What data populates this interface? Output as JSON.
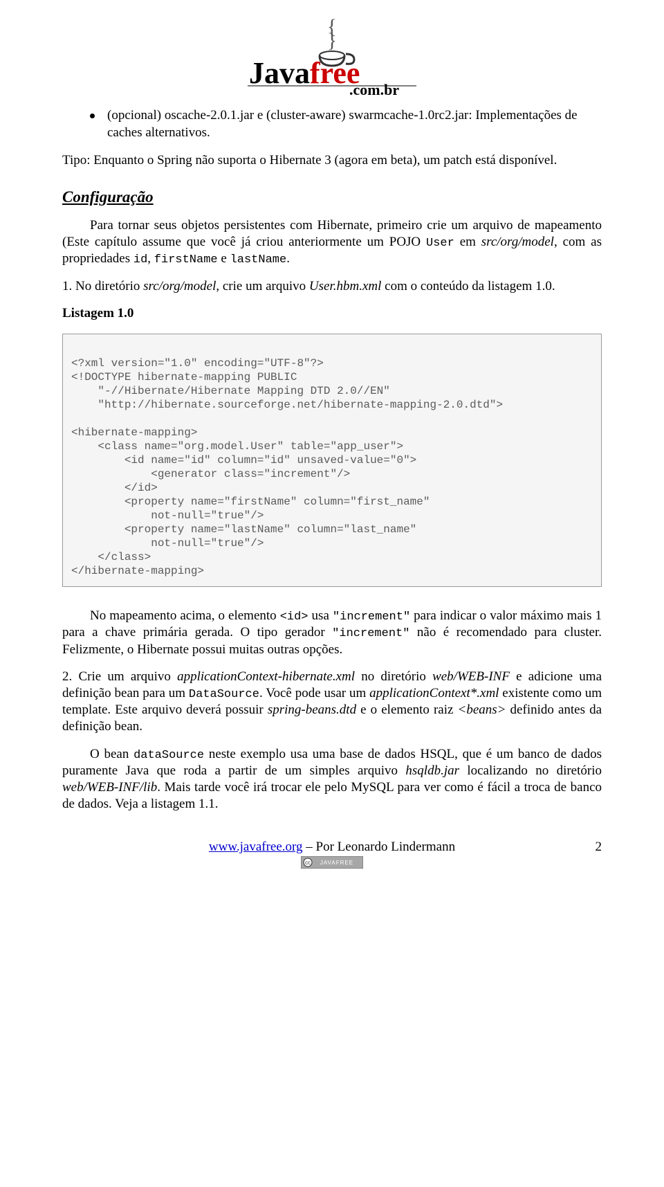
{
  "logo": {
    "brand_java": "Java",
    "brand_free": "free",
    "domain": ".com.br"
  },
  "bullet1_text": "(opcional) oscache-2.0.1.jar e (cluster-aware) swarmcache-1.0rc2.jar: Implementações de caches alternativos.",
  "tip_text": "Tipo: Enquanto o Spring não suporta o Hibernate 3 (agora em beta), um patch está disponível.",
  "config": {
    "heading": "Configuração",
    "intro_pre": "Para tornar seus objetos persistentes com Hibernate, primeiro crie um arquivo de mapeamento (Este capítulo assume que você já criou anteriormente um POJO ",
    "intro_code1": "User",
    "intro_mid": " em ",
    "intro_italic": "src/org/model",
    "intro_post": ", com as propriedades ",
    "intro_code2": "id",
    "intro_sep": ", ",
    "intro_code3": "firstName",
    "intro_and": " e ",
    "intro_code4": "lastName",
    "intro_end": "."
  },
  "step1": {
    "pre": "1. No diretório ",
    "italic1": "src/org/model",
    "mid1": ", crie um arquivo ",
    "italic2": "User.hbm.xml",
    "post": " com o conteúdo da listagem 1.0."
  },
  "listing1_label": "Listagem 1.0",
  "listing1_code": "\n<?xml version=\"1.0\" encoding=\"UTF-8\"?>\n<!DOCTYPE hibernate-mapping PUBLIC\n    \"-//Hibernate/Hibernate Mapping DTD 2.0//EN\"\n    \"http://hibernate.sourceforge.net/hibernate-mapping-2.0.dtd\">\n\n<hibernate-mapping>\n    <class name=\"org.model.User\" table=\"app_user\">\n        <id name=\"id\" column=\"id\" unsaved-value=\"0\">\n            <generator class=\"increment\"/>\n        </id>\n        <property name=\"firstName\" column=\"first_name\"\n            not-null=\"true\"/>\n        <property name=\"lastName\" column=\"last_name\"\n            not-null=\"true\"/>\n    </class>\n</hibernate-mapping>\n",
  "mapping_para": {
    "pre": "No mapeamento acima, o elemento ",
    "code1": "<id>",
    "mid1": " usa ",
    "code2": "\"increment\"",
    "mid2": " para indicar o valor máximo mais 1 para a chave primária gerada. O tipo gerador ",
    "code3": "\"increment\"",
    "post": " não é recomendado para cluster. Felizmente, o Hibernate possui muitas outras opções."
  },
  "step2": {
    "pre": "2. Crie um arquivo ",
    "italic1": "applicationContext-hibernate.xml",
    "mid1": " no diretório ",
    "italic2": "web/WEB-INF",
    "mid2": " e adicione uma definição bean para um ",
    "code1": "DataSource",
    "mid3": ". Você pode usar um ",
    "italic3": "applicationContext*.xml",
    "mid4": " existente como um template. Este arquivo deverá possuir ",
    "italic4": "spring-beans.dtd",
    "mid5": " e o elemento raiz ",
    "italic5": "<beans>",
    "post": " definido antes da definição bean."
  },
  "bean_para": {
    "pre": "O bean ",
    "code1": "dataSource",
    "mid1": " neste exemplo usa uma base de dados HSQL, que é um banco de dados puramente Java que roda a partir de um simples arquivo ",
    "italic1": "hsqldb.jar",
    "mid2": " localizando no diretório ",
    "italic2": "web/WEB-INF/lib",
    "post": ". Mais tarde você irá trocar ele pelo MySQL para ver como é fácil a troca de banco de dados. Veja a listagem 1.1."
  },
  "footer": {
    "link": "www.javafree.org",
    "author": " – Por Leonardo Lindermann",
    "page": "2",
    "badge": "JAVAFREE"
  }
}
